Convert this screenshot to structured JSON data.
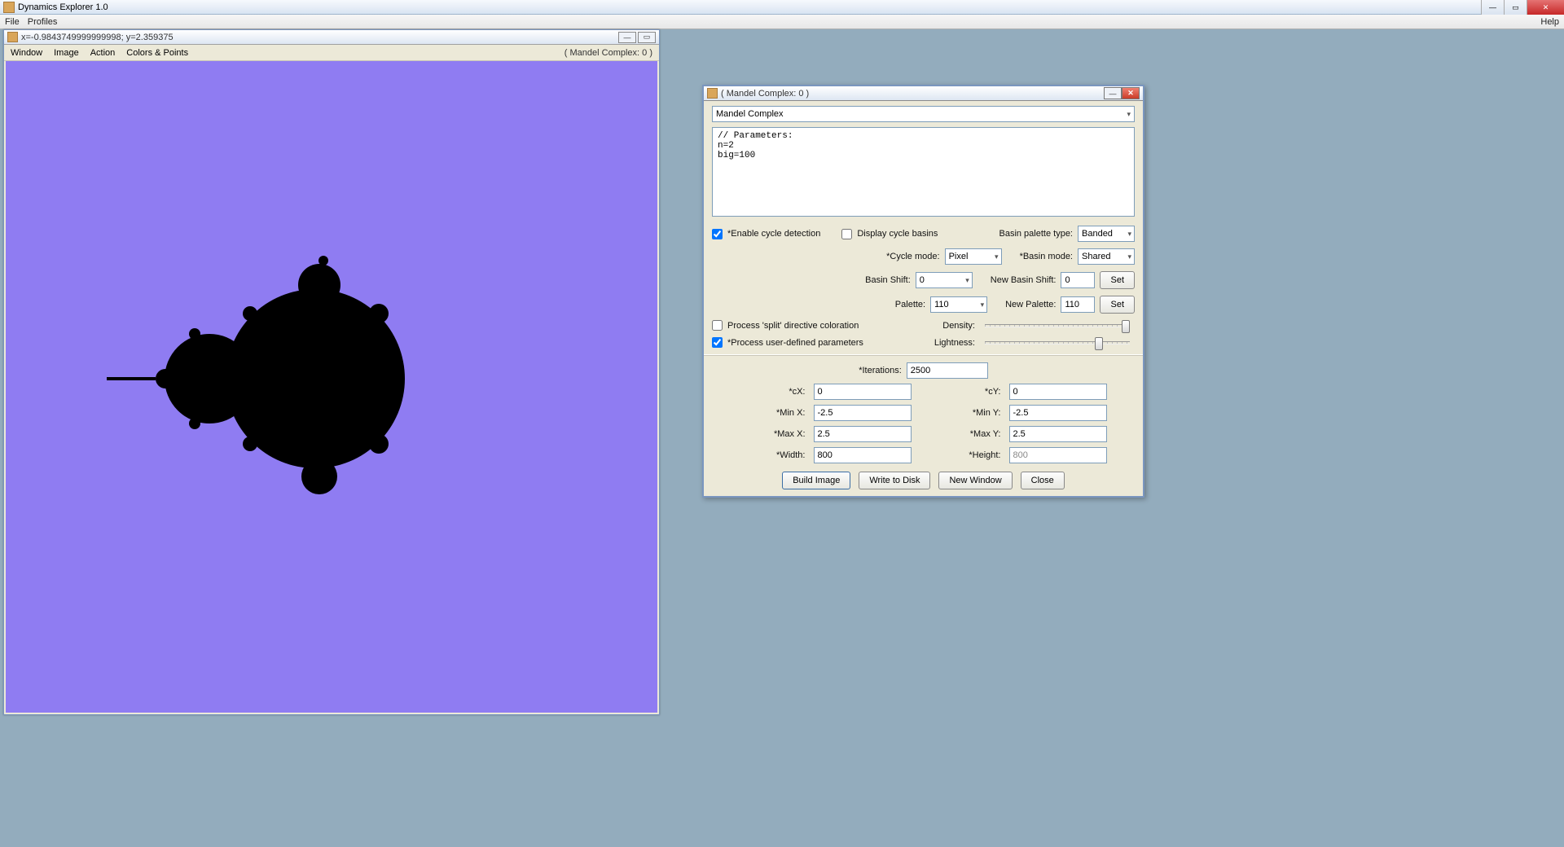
{
  "app": {
    "title": "Dynamics Explorer 1.0"
  },
  "menu": {
    "file": "File",
    "profiles": "Profiles",
    "help": "Help"
  },
  "imageWindow": {
    "coords": "x=-0.9843749999999998; y=2.359375",
    "menu": {
      "window": "Window",
      "image": "Image",
      "action": "Action",
      "colors": "Colors & Points"
    },
    "typeLabel": "( Mandel Complex: 0 )"
  },
  "dialog": {
    "title": "( Mandel Complex: 0 )",
    "typeSelected": "Mandel Complex",
    "paramsText": "// Parameters:\nn=2\nbig=100",
    "enableCycle": {
      "label": "*Enable cycle detection",
      "checked": true
    },
    "displayBasins": {
      "label": "Display cycle basins",
      "checked": false
    },
    "basinPaletteTypeLabel": "Basin palette type:",
    "basinPaletteType": "Banded",
    "cycleModeLabel": "*Cycle mode:",
    "cycleMode": "Pixel",
    "basinModeLabel": "*Basin mode:",
    "basinMode": "Shared",
    "basinShiftLabel": "Basin Shift:",
    "basinShift": "0",
    "newBasinShiftLabel": "New Basin Shift:",
    "newBasinShift": "0",
    "paletteLabel": "Palette:",
    "palette": "110",
    "newPaletteLabel": "New Palette:",
    "newPalette": "110",
    "setLabel": "Set",
    "processSplit": {
      "label": "Process 'split' directive coloration",
      "checked": false
    },
    "densityLabel": "Density:",
    "processUserParams": {
      "label": "*Process user-defined parameters",
      "checked": true
    },
    "lightnessLabel": "Lightness:",
    "iterationsLabel": "*Iterations:",
    "iterations": "2500",
    "cxLabel": "*cX:",
    "cx": "0",
    "cyLabel": "*cY:",
    "cy": "0",
    "minxLabel": "*Min X:",
    "minx": "-2.5",
    "minyLabel": "*Min Y:",
    "miny": "-2.5",
    "maxxLabel": "*Max X:",
    "maxx": "2.5",
    "maxyLabel": "*Max Y:",
    "maxy": "2.5",
    "widthLabel": "*Width:",
    "width": "800",
    "heightLabel": "*Height:",
    "height": "800",
    "buttons": {
      "build": "Build Image",
      "write": "Write to Disk",
      "newwin": "New Window",
      "close": "Close"
    }
  }
}
